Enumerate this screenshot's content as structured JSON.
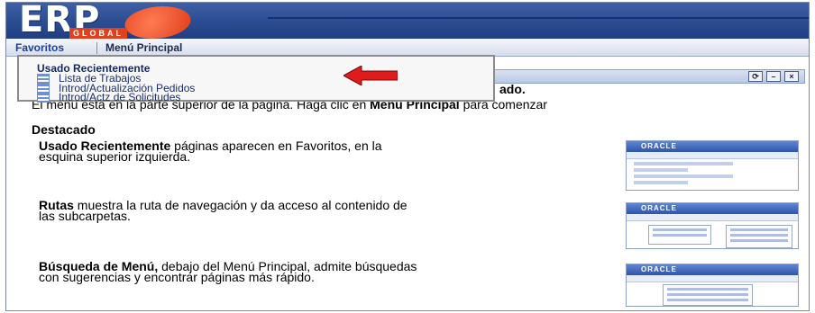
{
  "header": {
    "logo_text": "ERP",
    "logo_subtext": "GLOBAL"
  },
  "menubar": {
    "favorites_label": "Favoritos",
    "main_menu_label": "Menú Principal"
  },
  "favorites_dropdown": {
    "heading": "Usado Recientemente",
    "items": [
      {
        "label": "Lista de Trabajos",
        "icon": "document-icon"
      },
      {
        "label": "Introd/Actualización Pedidos",
        "icon": "document-icon"
      },
      {
        "label": "Introd/Actz de Solicitudes",
        "icon": "document-icon"
      }
    ],
    "pointer_icon": "red-arrow-icon",
    "pointer_color": "#e01b1b"
  },
  "pagelet": {
    "controls": [
      "refresh-icon",
      "minimize-icon",
      "close-icon"
    ]
  },
  "content": {
    "welcome_tail": "ado.",
    "intro_text_1": "El menú está en la parte superior de la página. Haga clic en ",
    "intro_bold": "Menú Principal",
    "intro_text_2": " para comenzar",
    "featured_heading": "Destacado",
    "features": [
      {
        "bold": "Usado Recientemente",
        "text": " páginas aparecen en Favoritos, en la esquina superior izquierda."
      },
      {
        "bold": "Rutas",
        "text": " muestra la ruta de navegación y da acceso al contenido de las subcarpetas."
      },
      {
        "bold": "Búsqueda de Menú,",
        "text": " debajo del Menú Principal, admite búsquedas con sugerencias y encontrar páginas más rápido."
      }
    ]
  },
  "thumbnails": {
    "brand_text": "ORACLE"
  },
  "colors": {
    "header_blue": "#2a4a94",
    "accent_red": "#e01b1b",
    "logo_orange": "#e0401c"
  }
}
